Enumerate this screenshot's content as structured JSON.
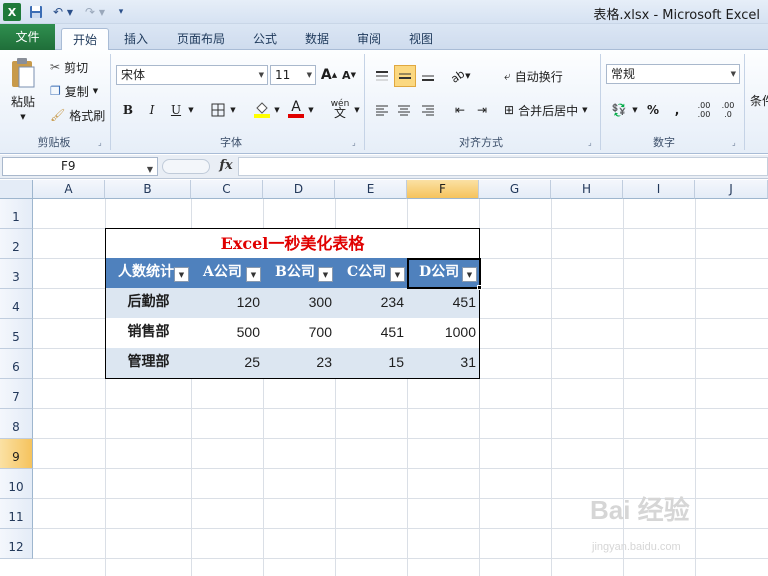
{
  "titlebar": {
    "app_icon": "X",
    "title": "表格.xlsx - Microsoft Excel"
  },
  "tabs": [
    "文件",
    "开始",
    "插入",
    "页面布局",
    "公式",
    "数据",
    "审阅",
    "视图"
  ],
  "ribbon": {
    "clipboard": {
      "paste": "粘贴",
      "cut": "剪切",
      "copy": "复制",
      "format_painter": "格式刷",
      "label": "剪贴板"
    },
    "font": {
      "name": "宋体",
      "size": "11",
      "bold": "B",
      "italic": "I",
      "underline": "U",
      "label": "字体",
      "grow": "A",
      "shrink": "A",
      "font_color_glyph": "A",
      "phonetic": "wén"
    },
    "alignment": {
      "wrap_text": "自动换行",
      "merge_center": "合并后居中",
      "label": "对齐方式"
    },
    "number": {
      "format": "常规",
      "percent": "%",
      "comma": ",",
      "label": "数字",
      "increase_decimal": ".00",
      "decrease_decimal": ".0"
    },
    "styles_partial": "条件"
  },
  "formula_bar": {
    "name_box": "F9",
    "fx": "fx",
    "formula": ""
  },
  "grid": {
    "columns": [
      "A",
      "B",
      "C",
      "D",
      "E",
      "F",
      "G",
      "H",
      "I",
      "J"
    ],
    "rows": [
      "1",
      "2",
      "3",
      "4",
      "5",
      "6",
      "7",
      "8",
      "9",
      "10",
      "11",
      "12"
    ],
    "active_cell": "F9"
  },
  "table": {
    "title": "Excel一秒美化表格",
    "headers": [
      "人数统计",
      "A公司",
      "B公司",
      "C公司",
      "D公司"
    ],
    "rows": [
      {
        "label": "后勤部",
        "values": [
          "120",
          "300",
          "234",
          "451"
        ]
      },
      {
        "label": "销售部",
        "values": [
          "500",
          "700",
          "451",
          "1000"
        ]
      },
      {
        "label": "管理部",
        "values": [
          "25",
          "23",
          "15",
          "31"
        ]
      }
    ]
  },
  "watermark": {
    "brand": "Bai 经验",
    "url": "jingyan.baidu.com"
  },
  "colors": {
    "header_blue": "#4f81bd",
    "band_blue": "#dce6f1",
    "title_red": "#e00000",
    "file_tab_green": "#1f6e39"
  }
}
